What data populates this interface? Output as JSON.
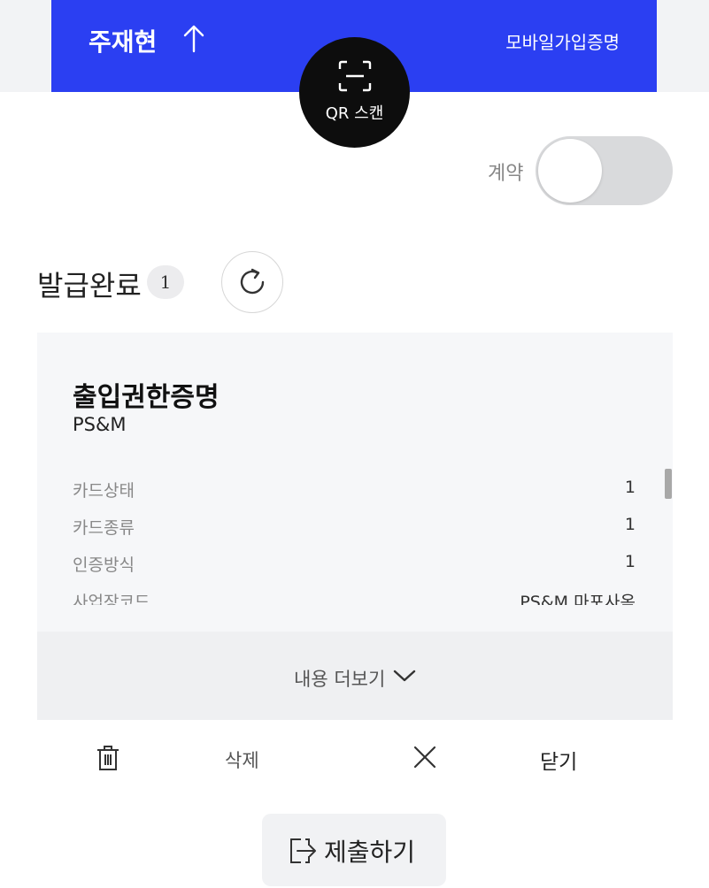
{
  "header": {
    "user_name": "주재현",
    "up_icon": "arrow-up-icon",
    "right_link": "모바일가입증명",
    "bg_color": "#2b3ff2"
  },
  "qr_button": {
    "label": "QR 스캔",
    "icon": "qr-scan-icon"
  },
  "contract": {
    "label": "계약",
    "toggle_on": false
  },
  "section": {
    "title": "발급완료",
    "count": "1",
    "refresh_icon": "refresh-icon"
  },
  "card": {
    "title": "출입권한증명",
    "subtitle": "PS&M",
    "rows": [
      {
        "key": "카드상태",
        "value": "1"
      },
      {
        "key": "카드종류",
        "value": "1"
      },
      {
        "key": "인증방식",
        "value": "1"
      },
      {
        "key": "사업장코드",
        "value": "PS&M 마포사옥"
      }
    ],
    "more_label": "내용 더보기",
    "more_icon": "chevron-down-icon"
  },
  "actions": {
    "delete_icon": "trash-icon",
    "delete_label": "삭제",
    "close_icon": "close-icon",
    "close_label": "닫기"
  },
  "submit": {
    "label": "제출하기",
    "icon": "submit-icon"
  }
}
